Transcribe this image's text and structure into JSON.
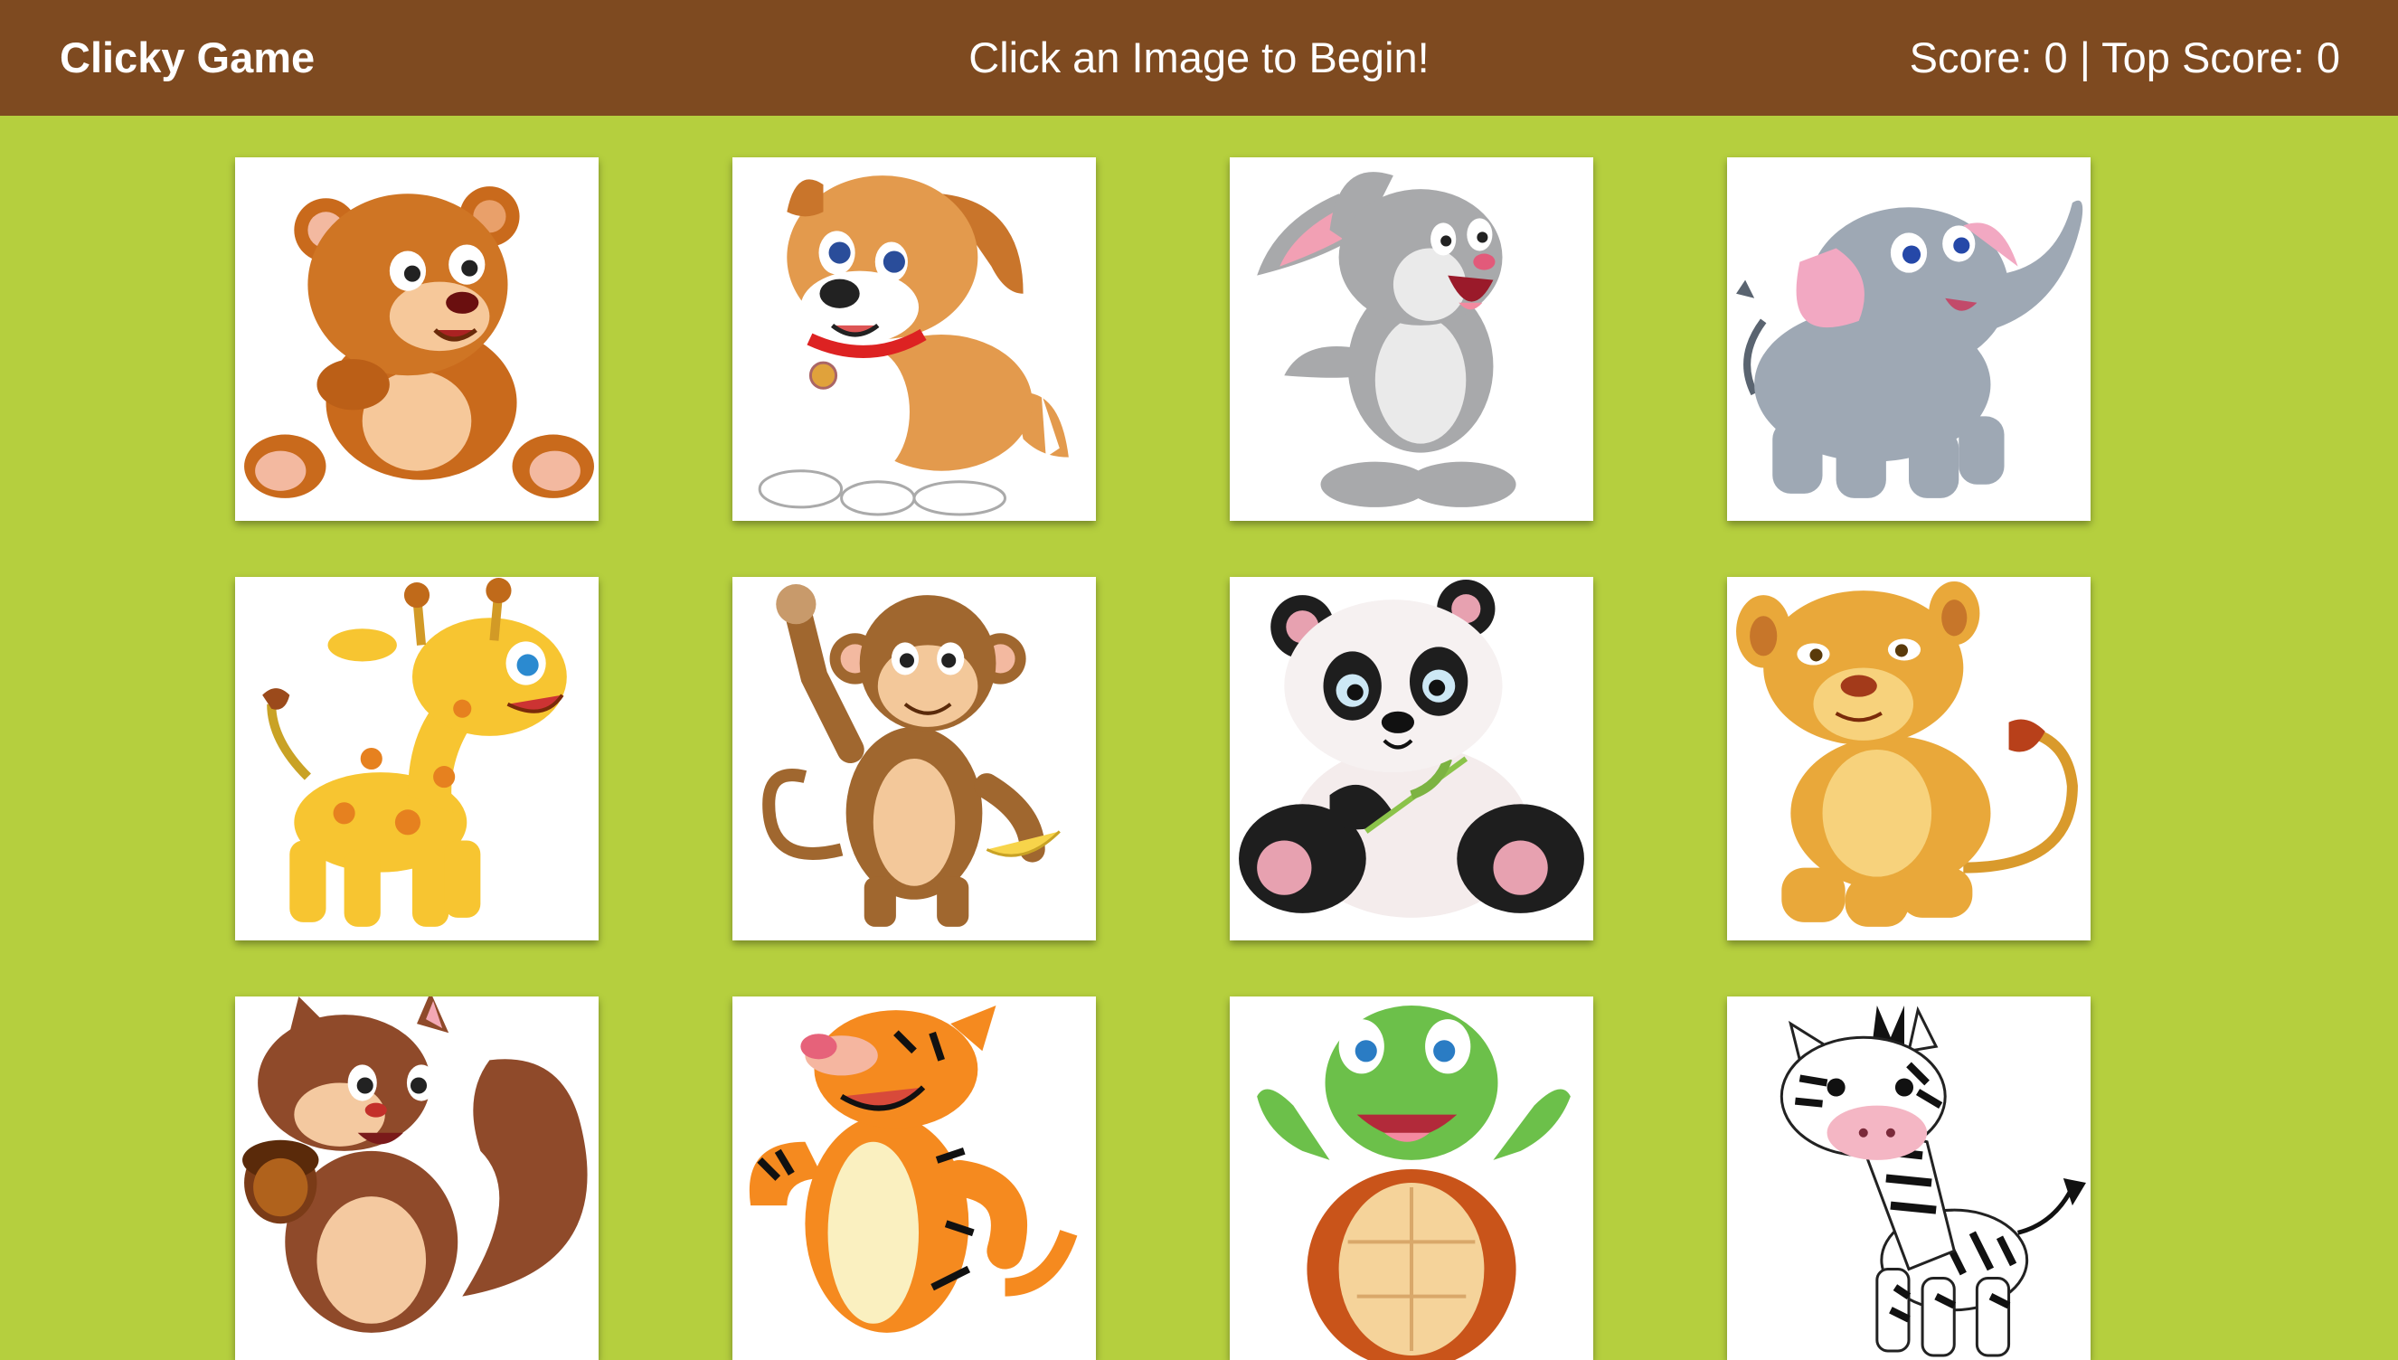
{
  "navbar": {
    "brand": "Clicky Game",
    "message": "Click an Image to Begin!",
    "score_text": "Score: 0 | Top Score: 0",
    "background": "#7e4a20"
  },
  "game": {
    "background": "#b5cf3e",
    "score": 0,
    "top_score": 0
  },
  "cards": [
    {
      "icon": "bear-icon"
    },
    {
      "icon": "puppy-icon"
    },
    {
      "icon": "bunny-icon"
    },
    {
      "icon": "elephant-icon"
    },
    {
      "icon": "giraffe-icon"
    },
    {
      "icon": "monkey-icon"
    },
    {
      "icon": "panda-icon"
    },
    {
      "icon": "lion-icon"
    },
    {
      "icon": "squirrel-icon"
    },
    {
      "icon": "tiger-icon"
    },
    {
      "icon": "turtle-icon"
    },
    {
      "icon": "zebra-icon"
    }
  ]
}
